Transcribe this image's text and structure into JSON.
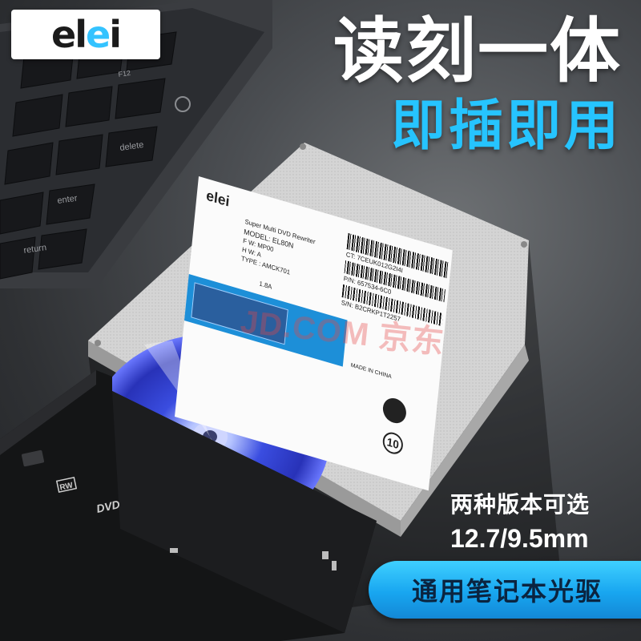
{
  "brand": {
    "logo_prefix": "el",
    "logo_accent": "e",
    "logo_suffix": "i"
  },
  "headline": {
    "line1": "读刻一体",
    "line2": "即插即用"
  },
  "keyboard_keys": {
    "f12": "F12",
    "delete": "delete",
    "enter": "enter",
    "return": "return"
  },
  "drive_label": {
    "logo": "elei",
    "desc": "Super Multi DVD Rewriter",
    "model": "MODEL: EL80N",
    "f": "F   W: MP00",
    "h": "H   W: A",
    "type": "TYPE  : AMCK701",
    "power": "1.8A",
    "ct": "CT: 7CEUK012G2I4I",
    "pn": "P/N: 657534-6C0",
    "sn": "S/N: B2CRKP1T2257",
    "country": "MADE IN CHINA",
    "eco": "10"
  },
  "tray": {
    "rw_badge": "RW",
    "dvd_logo": "DVD"
  },
  "watermark": "JD.COM 京东",
  "variants": {
    "line1": "两种版本可选",
    "line2": "12.7/9.5mm"
  },
  "banner": {
    "text": "通用笔记本光驱"
  },
  "colors": {
    "accent": "#26c4ff",
    "banner": "#18a6f0",
    "sticker_blue": "#1d8fd8"
  }
}
